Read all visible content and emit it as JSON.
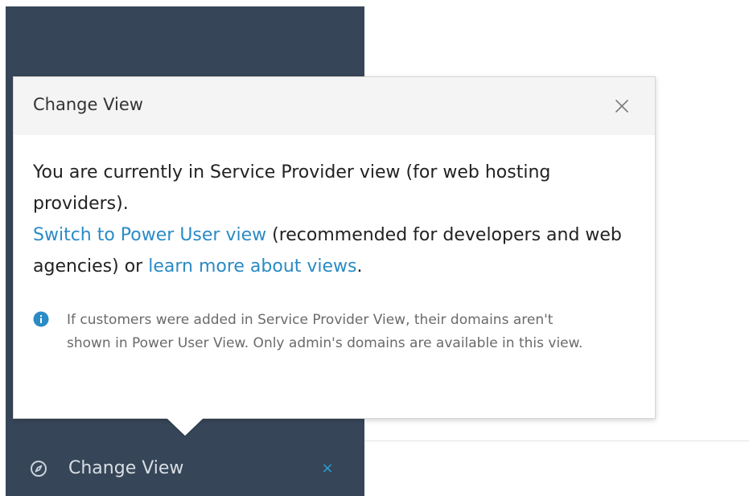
{
  "sidebar": {
    "change_view_label": "Change View",
    "change_view_icon": "compass-icon",
    "close_glyph": "×",
    "background_color": "#364658"
  },
  "popover": {
    "title": "Change View",
    "close_icon": "close-icon",
    "line1": "You are currently in Service Provider view (for web hosting providers).",
    "switch_link": "Switch to Power User view",
    "mid_text": " (recommended for developers and web agencies) or ",
    "learn_link": "learn more about views",
    "end_text": ".",
    "note_icon": "info-icon",
    "note_text": "If customers were added in Service Provider View, their domains aren't shown in Power User View. Only admin's domains are available in this view.",
    "link_color": "#2a8bc6"
  }
}
